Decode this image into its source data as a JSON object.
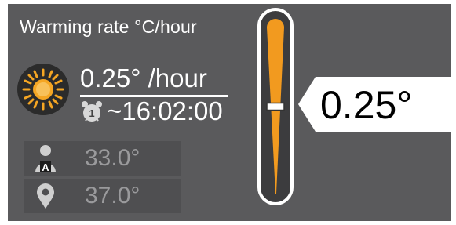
{
  "title": "Warming rate °C/hour",
  "rate_text": "0.25° /hour",
  "eta_text": "~16:02:00",
  "alarm_badge": "1",
  "references": [
    {
      "icon": "person-a-icon",
      "badge": "A",
      "value": "33.0°"
    },
    {
      "icon": "location-pin-icon",
      "value": "37.0°"
    }
  ],
  "gauge": {
    "value_text": "0.25°",
    "level_fraction": 0.5
  },
  "colors": {
    "panel": "#5a5a5c",
    "accent_orange": "#f29a1f",
    "text": "#ffffff",
    "muted_text": "#9a9a9c"
  }
}
